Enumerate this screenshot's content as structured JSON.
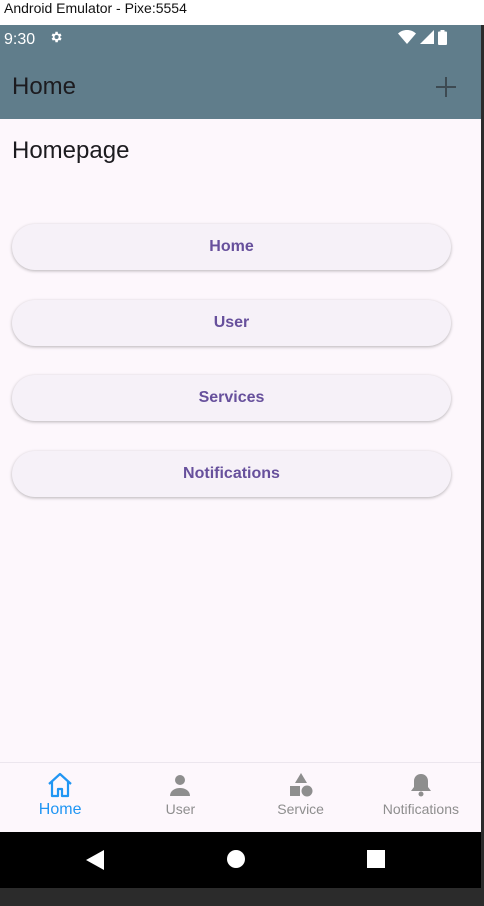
{
  "window": {
    "title": "Android Emulator - Pixe:5554"
  },
  "status_bar": {
    "time": "9:30"
  },
  "app_bar": {
    "title": "Home",
    "action_icon": "plus-icon"
  },
  "page": {
    "heading": "Homepage",
    "buttons": [
      "Home",
      "User",
      "Services",
      "Notifications"
    ]
  },
  "bottom_nav": {
    "items": [
      {
        "label": "Home",
        "icon": "home-icon",
        "active": true
      },
      {
        "label": "User",
        "icon": "person-icon",
        "active": false
      },
      {
        "label": "Service",
        "icon": "shapes-icon",
        "active": false
      },
      {
        "label": "Notifications",
        "icon": "bell-icon",
        "active": false
      }
    ]
  },
  "colors": {
    "app_bar": "#607d8b",
    "button_text": "#67509c",
    "nav_active": "#2196f3",
    "nav_inactive": "#8e8e8e",
    "background": "#fdf7fc"
  }
}
